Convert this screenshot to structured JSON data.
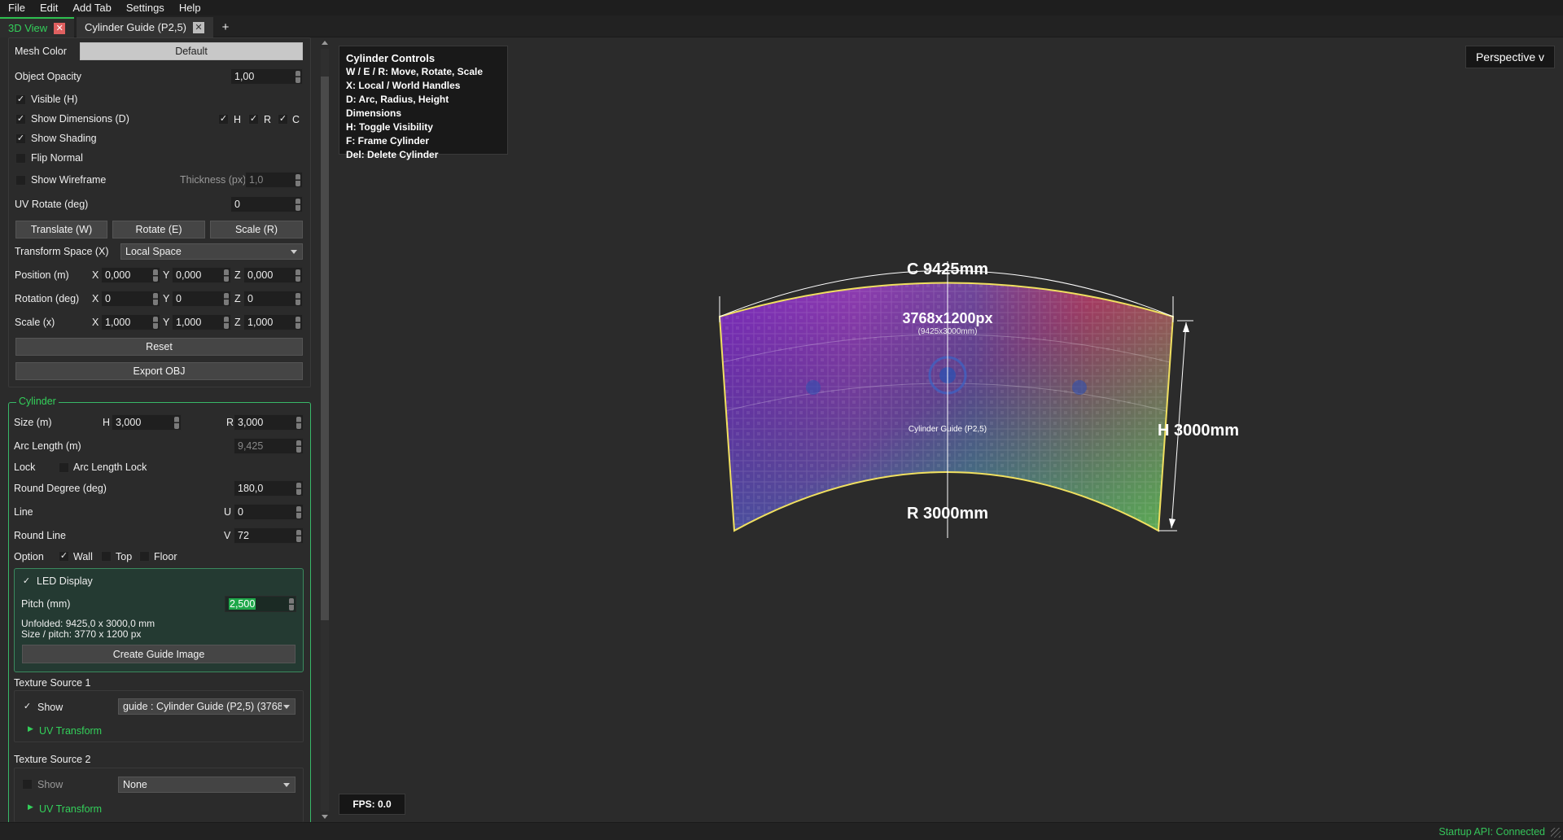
{
  "menu": [
    "File",
    "Edit",
    "Add Tab",
    "Settings",
    "Help"
  ],
  "tabs": [
    {
      "label": "3D View",
      "active": true
    },
    {
      "label": "Cylinder Guide (P2,5)",
      "active": false
    }
  ],
  "tab_add_label": "+",
  "panel": {
    "mesh_color_label": "Mesh Color",
    "mesh_color_value": "Default",
    "object_opacity_label": "Object Opacity",
    "object_opacity_value": "1,00",
    "visible_label": "Visible (H)",
    "show_dimensions_label": "Show Dimensions (D)",
    "dim_h": "H",
    "dim_r": "R",
    "dim_c": "C",
    "show_shading_label": "Show Shading",
    "flip_normal_label": "Flip Normal",
    "show_wireframe_label": "Show Wireframe",
    "thickness_label": "Thickness (px)",
    "thickness_value": "1,0",
    "uv_rotate_label": "UV Rotate (deg)",
    "uv_rotate_value": "0",
    "translate_label": "Translate (W)",
    "rotate_label": "Rotate (E)",
    "scale_label": "Scale (R)",
    "transform_space_label": "Transform Space (X)",
    "transform_space_value": "Local Space",
    "position_label": "Position (m)",
    "position": {
      "x": "0,000",
      "y": "0,000",
      "z": "0,000"
    },
    "rotation_label": "Rotation (deg)",
    "rotation": {
      "x": "0",
      "y": "0",
      "z": "0"
    },
    "scale_row_label": "Scale (x)",
    "scale": {
      "x": "1,000",
      "y": "1,000",
      "z": "1,000"
    },
    "axis_x": "X",
    "axis_y": "Y",
    "axis_z": "Z",
    "reset_label": "Reset",
    "export_label": "Export OBJ"
  },
  "cylinder": {
    "group_title": "Cylinder",
    "size_label": "Size (m)",
    "size_h_label": "H",
    "size_h": "3,000",
    "size_r_label": "R",
    "size_r": "3,000",
    "arc_length_label": "Arc Length (m)",
    "arc_length_value": "9,425",
    "lock_label": "Lock",
    "arc_length_lock_label": "Arc Length Lock",
    "round_degree_label": "Round Degree (deg)",
    "round_degree_value": "180,0",
    "line_label": "Line",
    "line_u_label": "U",
    "line_u": "0",
    "round_line_label": "Round Line",
    "round_line_v_label": "V",
    "round_line_v": "72",
    "option_label": "Option",
    "wall_label": "Wall",
    "top_label": "Top",
    "floor_label": "Floor",
    "led_display_label": "LED Display",
    "pitch_label": "Pitch (mm)",
    "pitch_value": "2,500",
    "unfolded_text": "Unfolded: 9425,0 x 3000,0 mm",
    "size_pitch_text": "Size / pitch: 3770 x 1200 px",
    "create_guide_label": "Create Guide Image",
    "texture1_label": "Texture Source 1",
    "texture1_show_label": "Show",
    "texture1_value": "guide : Cylinder Guide (P2,5) (3768",
    "uv_transform_label": "UV Transform",
    "texture2_label": "Texture Source 2",
    "texture2_show_label": "Show",
    "texture2_value": "None",
    "uv_transform2_label": "UV Transform"
  },
  "viewport": {
    "controls_title": "Cylinder Controls",
    "controls_lines": [
      "W / E / R: Move, Rotate, Scale",
      "X: Local / World Handles",
      "D: Arc, Radius, Height Dimensions",
      "H: Toggle Visibility",
      "F: Frame Cylinder",
      "Del: Delete Cylinder"
    ],
    "perspective_label": "Perspective v",
    "fps_label": "FPS: 0.0",
    "dim_c_label": "C 9425mm",
    "dim_h_label": "H 3000mm",
    "dim_r_label": "R 3000mm",
    "guide_px_label": "3768x1200px",
    "guide_mm_label": "(9425x3000mm)",
    "guide_name_label": "Cylinder Guide (P2,5)"
  },
  "status": "Startup API: Connected",
  "colors": {
    "accent": "#2ec050",
    "status_green": "#35c45a",
    "highlight": "#1fa84a",
    "outline_yellow": "#f0e060"
  }
}
